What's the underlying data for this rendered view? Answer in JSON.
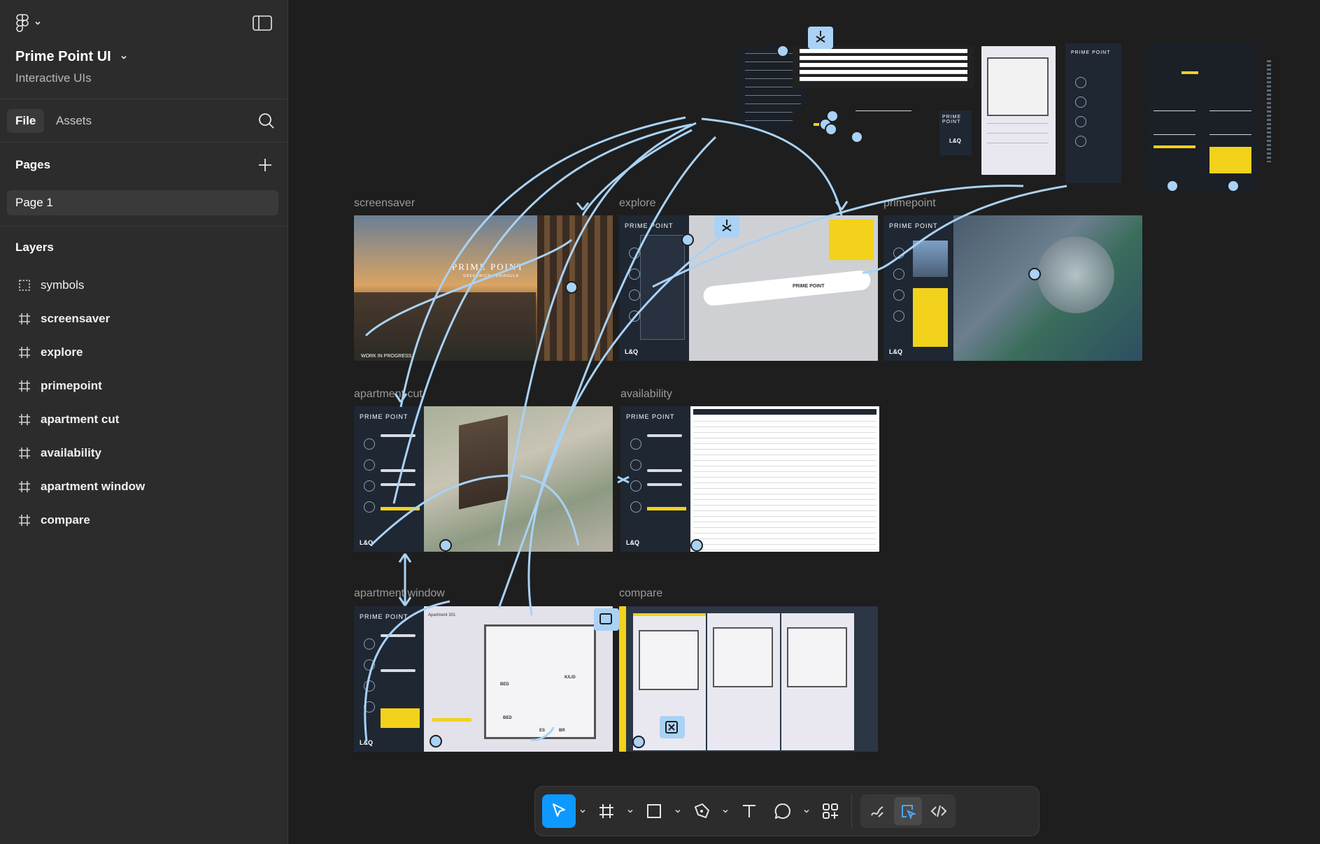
{
  "sidebar": {
    "project_title": "Prime Point UI",
    "project_subtitle": "Interactive UIs",
    "tabs": [
      {
        "label": "File",
        "active": true
      },
      {
        "label": "Assets",
        "active": false
      }
    ],
    "pages_heading": "Pages",
    "pages": [
      {
        "label": "Page 1",
        "selected": true
      }
    ],
    "layers_heading": "Layers",
    "layers": [
      {
        "label": "symbols",
        "icon": "section-icon"
      },
      {
        "label": "screensaver",
        "icon": "frame-icon"
      },
      {
        "label": "explore",
        "icon": "frame-icon"
      },
      {
        "label": "primepoint",
        "icon": "frame-icon"
      },
      {
        "label": "apartment cut",
        "icon": "frame-icon"
      },
      {
        "label": "availability",
        "icon": "frame-icon"
      },
      {
        "label": "apartment window",
        "icon": "frame-icon"
      },
      {
        "label": "compare",
        "icon": "frame-icon"
      }
    ]
  },
  "canvas": {
    "frames": [
      {
        "id": "screensaver",
        "label": "screensaver"
      },
      {
        "id": "explore",
        "label": "explore"
      },
      {
        "id": "primepoint",
        "label": "primepoint"
      },
      {
        "id": "apartment-cut",
        "label": "apartment cut"
      },
      {
        "id": "availability",
        "label": "availability"
      },
      {
        "id": "apartment-window",
        "label": "apartment window"
      },
      {
        "id": "compare",
        "label": "compare"
      }
    ],
    "screensaver_text": {
      "brand": "PRIME POINT",
      "tagline": "GREENWICH PENINSULA",
      "footer": "WORK IN PROGRESS"
    },
    "thumb_brand": "PRIME POINT",
    "thumb_partner": "L&Q",
    "map_label": "PRIME POINT",
    "apartment_title": "Apartment 301",
    "room_labels": {
      "bed1": "BED",
      "bed2": "BED",
      "kitchen": "K/L/D",
      "bath1": "ES",
      "bath2": "BR"
    }
  },
  "toolbar": {
    "tools": [
      "move-tool",
      "frame-tool",
      "rectangle-tool",
      "pen-tool",
      "text-tool",
      "comment-tool",
      "actions-tool"
    ],
    "modes": [
      "draw-mode",
      "design-mode",
      "dev-mode"
    ],
    "active_tool": "move-tool",
    "active_mode": "design-mode"
  },
  "colors": {
    "accent": "#0d99ff",
    "flow": "#a9d2f5",
    "brand_yellow": "#f2d21a",
    "nav_bg": "#1f2733"
  }
}
